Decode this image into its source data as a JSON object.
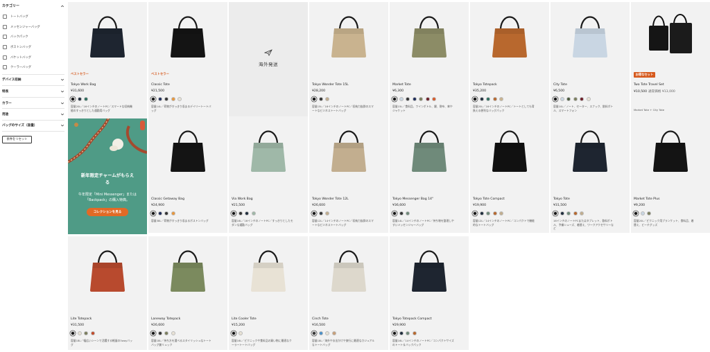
{
  "sidebar": {
    "category_title": "カテゴリー",
    "categories": [
      "トートバッグ",
      "メッセンジャーバッグ",
      "バックパック",
      "ボストンバッグ",
      "バケットバッグ",
      "クーラーバッグ"
    ],
    "sections": [
      "デバイス収納",
      "特長",
      "カラー",
      "用途",
      "バッグのサイズ（容量）"
    ],
    "reset_label": "条件をリセット"
  },
  "overseas_label": "海外発送",
  "promo": {
    "title_line1": "新年限定チャームがもらえ",
    "title_line2": "る",
    "body_line1": "午年限定「Mini Messenger」または",
    "body_line2": "「Backpack」の購入特典。",
    "cta": "コレクションを見る",
    "bg_color": "#4f9b86",
    "cta_color": "#e26a26"
  },
  "products": [
    {
      "name": "Tokyo Work Bag",
      "price": "¥31,600",
      "badge": "ベストセラー",
      "badge_style": "text",
      "swatches": [
        "#111111",
        "#1f2d3d",
        "#2d6e5e"
      ],
      "desc": [
        "容量20L／16インチのノートPC／スマートな収納機",
        "能のすっきりとした通勤用バッグ"
      ],
      "bag_color": "#1e2530"
    },
    {
      "name": "Classic Tote",
      "price": "¥21,500",
      "badge": "ベストセラー",
      "badge_style": "text",
      "swatches": [
        "#111111",
        "#1f2d5a",
        "#333333",
        "#e8983e",
        "#e8e2d5"
      ],
      "desc": [
        "容量14L／荷物がすっきり収まるデイリートートバ",
        "ッグ"
      ],
      "bag_color": "#141414"
    },
    {
      "name": "Tokyo Wonder Tote 15L",
      "price": "¥28,200",
      "swatches": [
        "#111111",
        "#333333",
        "#c2ae8f"
      ],
      "desc": [
        "容量15L／16インチのノートPC／収納力抜群のスマ",
        "ートなビジネストートバッグ"
      ],
      "bag_color": "#c9b38f"
    },
    {
      "name": "Market Tote",
      "price": "¥6,300",
      "swatches": [
        "#111111",
        "#c9d6e3",
        "#333333",
        "#1f2d5a",
        "#7b7f5e",
        "#6e1e28",
        "#d85a2a"
      ],
      "desc": [
        "容量15L／食料品、ワインボトル、鍵、財布、傘や",
        "ジャケット"
      ],
      "bag_color": "#8c8c66"
    },
    {
      "name": "Tokyo Totepack",
      "price": "¥35,200",
      "swatches": [
        "#111111",
        "#1f2d3d",
        "#2d6e5e",
        "#b8682e",
        "#c9b38f"
      ],
      "desc": [
        "容量20L／16インチのノートPC／トートとしても背",
        "負える便利なバッグパック"
      ],
      "bag_color": "#b8682e"
    },
    {
      "name": "City Tote",
      "price": "¥6,500",
      "swatches": [
        "#111111",
        "#c9d6e3",
        "#4a5a3d",
        "#7b7f5e",
        "#6e1e28",
        "#e8e2d5"
      ],
      "desc": [
        "容量10L／ノート、セーター、スナック、飲料ボト",
        "ル、スマートフォン"
      ],
      "bag_color": "#c9d6e3"
    },
    {
      "name": "Two Tote Travel Set",
      "price": "¥10,500",
      "price_sub": "通常価格 ¥13,000",
      "badge": "お得なセット",
      "badge_style": "box",
      "swatches": [],
      "desc": [
        "Market Tote + City Tote"
      ],
      "bag_color": "#111111"
    },
    {
      "name": "Classic Getaway Bag",
      "price": "¥24,900",
      "swatches": [
        "#111111",
        "#1f2d5a",
        "#333333",
        "#e8983e"
      ],
      "desc": [
        "容量38L／荷物がすっきり収まるボストンバッグ"
      ],
      "bag_color": "#141414"
    },
    {
      "name": "Via Work Bag",
      "price": "¥21,500",
      "swatches": [
        "#111111",
        "#333333",
        "#1f2d3d",
        "#9fb8a8"
      ],
      "desc": [
        "容量16L／16インチのノートPC／すっきりとしたモ",
        "ダンな通勤バッグ"
      ],
      "bag_color": "#9fb8a8"
    },
    {
      "name": "Tokyo Wonder Tote 12L",
      "price": "¥26,600",
      "swatches": [
        "#111111",
        "#333333",
        "#c2ae8f"
      ],
      "desc": [
        "容量12L／14インチのノートPC／収納力抜群のスマ",
        "ートなビジネストートバッグ"
      ],
      "bag_color": "#c2ae8f"
    },
    {
      "name": "Tokyo Messenger Bag 14\"",
      "price": "¥36,600",
      "swatches": [
        "#111111",
        "#333333",
        "#6f8a7a"
      ],
      "desc": [
        "容量14L／14インチのノートPC／持ち物を整理しや",
        "すいメッセンジャーバッグ"
      ],
      "bag_color": "#6f8a7a"
    },
    {
      "name": "Tokyo Tote Compact",
      "price": "¥19,900",
      "swatches": [
        "#111111",
        "#1f2d3d",
        "#6f8a7a",
        "#b8682e",
        "#c2ae8f"
      ],
      "desc": [
        "容量12L／14インチのノートPC／コンパクトで機能",
        "的なトートバッグ"
      ],
      "bag_color": "#111111"
    },
    {
      "name": "Tokyo Tote",
      "price": "¥31,500",
      "swatches": [
        "#111111",
        "#1f2d3d",
        "#6f8a7a",
        "#b8682e",
        "#c2ae8f"
      ],
      "desc": [
        "16インチのノートPCまたはタブレット、飲料ボト",
        "ル、予備シューズ、着替え、ワークアクセサリーな",
        "ど"
      ],
      "bag_color": "#1e2530"
    },
    {
      "name": "Market Tote Plus",
      "price": "¥9,200",
      "swatches": [
        "#111111",
        "#c9d6e3",
        "#7b7f5e"
      ],
      "desc": [
        "容量20L／ピクニック用ブランケット、食料品、着",
        "替え、ビーチグッズ"
      ],
      "bag_color": "#141414"
    },
    {
      "name": "Lite Totepack",
      "price": "¥31,500",
      "swatches": [
        "#111111",
        "#e8e2d5",
        "#7b7f5e",
        "#c24a2a"
      ],
      "desc": [
        "容量18L／幅広いシーンで活躍する軽量の3wayバッ",
        "グ"
      ],
      "bag_color": "#b84a2e"
    },
    {
      "name": "Laneway Totepack",
      "price": "¥26,600",
      "swatches": [
        "#111111",
        "#333333",
        "#7b7f5e",
        "#e8e2d5"
      ],
      "desc": [
        "容量18L／持ち方を選べるスタイリッシュなトート",
        "バッグ兼リュック"
      ],
      "bag_color": "#7b8a5e"
    },
    {
      "name": "Lite Cooler Tote",
      "price": "¥15,200",
      "swatches": [
        "#111111",
        "#e8e2d5"
      ],
      "desc": [
        "容量16L／ピクニックや食料品の買い物に最適なク",
        "ーラートートバッグ"
      ],
      "bag_color": "#e8e2d5"
    },
    {
      "name": "Cinch Tote",
      "price": "¥16,500",
      "swatches": [
        "#333333",
        "#4a90c8",
        "#e8e2d5",
        "#c9a07a"
      ],
      "desc": [
        "容量18L／海外やお出かけや旅行に最適なカジュアル",
        "なトートバッグ"
      ],
      "bag_color": "#ddd8cc"
    },
    {
      "name": "Tokyo Totepack Compact",
      "price": "¥29,900",
      "swatches": [
        "#111111",
        "#1f2d3d",
        "#6f8a7a",
        "#b8682e"
      ],
      "desc": [
        "容量16L／14インチのノートPC／コンパクトサイズ",
        "のトート＆バックパック"
      ],
      "bag_color": "#1e2530"
    }
  ]
}
